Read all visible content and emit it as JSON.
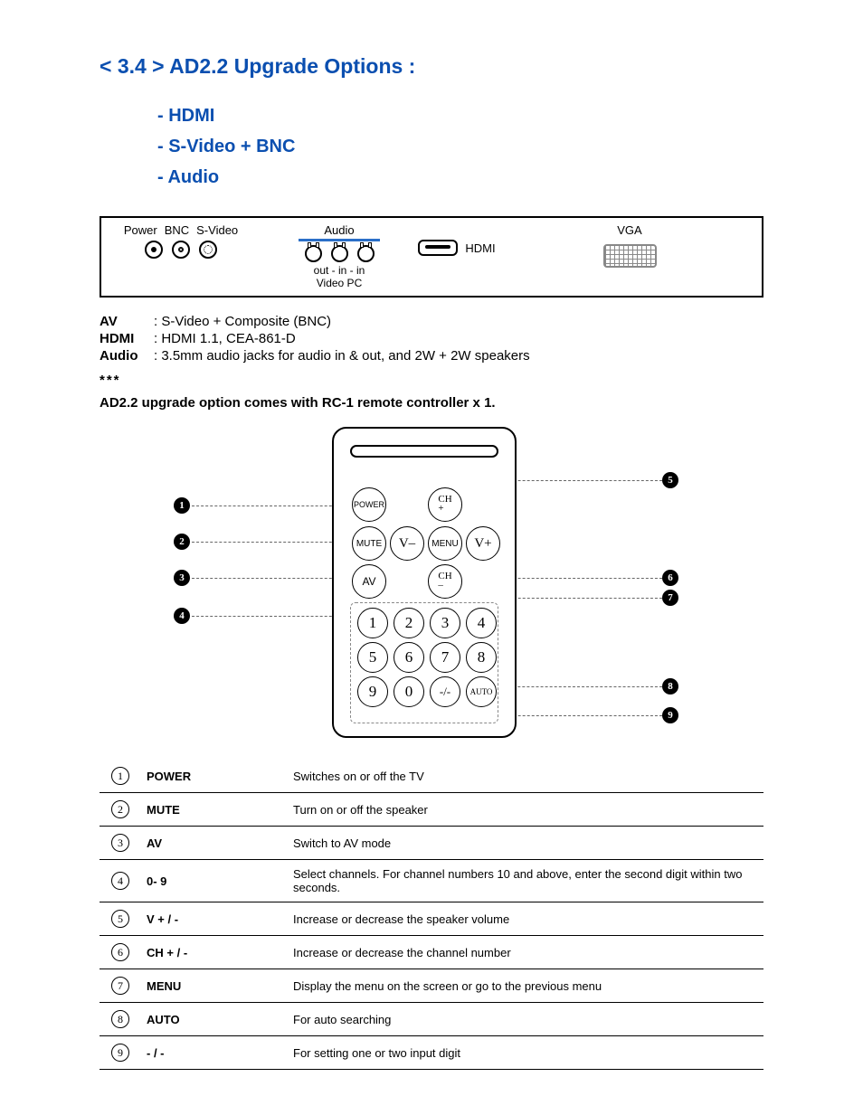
{
  "heading": "< 3.4 > AD2.2 Upgrade Options :",
  "options": [
    "- HDMI",
    "- S-Video + BNC",
    "- Audio"
  ],
  "panel": {
    "power_lbl": "Power",
    "bnc_lbl": "BNC",
    "svid_lbl": "S-Video",
    "audio_lbl": "Audio",
    "audio_sub": "out  -  in  -  in",
    "audio_sub2": "Video   PC",
    "hdmi_lbl": "HDMI",
    "vga_lbl": "VGA"
  },
  "specs": {
    "av": {
      "k": "AV",
      "v": ": S-Video + Composite (BNC)"
    },
    "hdmi": {
      "k": "HDMI",
      "v": ": HDMI 1.1, CEA-861-D"
    },
    "audio": {
      "k": "Audio",
      "v": ": 3.5mm audio jacks for audio in & out, and 2W + 2W speakers"
    }
  },
  "stars": "***",
  "note": "AD2.2 upgrade option comes with RC-1 remote controller x 1.",
  "remote_buttons": {
    "power": "POWER",
    "mute": "MUTE",
    "av": "AV",
    "ch_up": "CH\n+",
    "ch_dn": "CH\n–",
    "v_up": "V+",
    "v_dn": "V–",
    "menu": "MENU",
    "dash": "-/-",
    "auto": "AUTO",
    "d1": "1",
    "d2": "2",
    "d3": "3",
    "d4": "4",
    "d5": "5",
    "d6": "6",
    "d7": "7",
    "d8": "8",
    "d9": "9",
    "d0": "0"
  },
  "functions": [
    {
      "n": "1",
      "k": "POWER",
      "d": "Switches on or off the TV"
    },
    {
      "n": "2",
      "k": "MUTE",
      "d": "Turn on or off the speaker"
    },
    {
      "n": "3",
      "k": "AV",
      "d": "Switch to AV mode"
    },
    {
      "n": "4",
      "k": "0- 9",
      "d": "Select channels. For channel numbers 10 and above, enter the second digit within two seconds."
    },
    {
      "n": "5",
      "k": "V + / -",
      "d": "Increase or decrease the speaker volume"
    },
    {
      "n": "6",
      "k": "CH + / -",
      "d": "Increase or decrease the channel number"
    },
    {
      "n": "7",
      "k": "MENU",
      "d": "Display the menu on the screen or go to the previous menu"
    },
    {
      "n": "8",
      "k": "AUTO",
      "d": "For auto searching"
    },
    {
      "n": "9",
      "k": "- / -",
      "d": "For setting one or two input digit"
    }
  ]
}
